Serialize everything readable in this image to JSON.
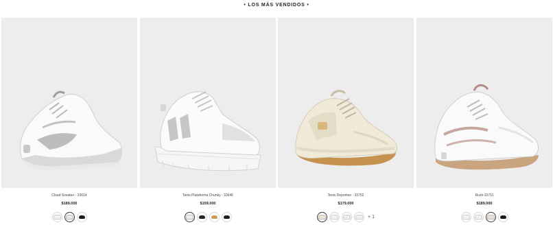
{
  "section": {
    "title": "• LOS MÁS VENDIDOS •"
  },
  "products": [
    {
      "name": "Cloud Sneaker - 33014",
      "price": "$189.000",
      "swatches": [
        {
          "color": "#f2f2f2",
          "selected": false
        },
        {
          "color": "#e9e7e2",
          "selected": true
        },
        {
          "color": "#1c1c1c",
          "selected": false
        }
      ],
      "more": ""
    },
    {
      "name": "Tenis Plataforma Chunky - 33645",
      "price": "$159.000",
      "swatches": [
        {
          "color": "#efeeea",
          "selected": true
        },
        {
          "color": "#2a2624",
          "selected": false
        },
        {
          "color": "#c79a5c",
          "selected": false
        },
        {
          "color": "#1e1e1e",
          "selected": false
        }
      ],
      "more": ""
    },
    {
      "name": "Tenis Deportivo - 33752",
      "price": "$179.000",
      "swatches": [
        {
          "color": "#ebe4d2",
          "selected": true
        },
        {
          "color": "#f1f1f1",
          "selected": false
        },
        {
          "color": "#ededed",
          "selected": false
        },
        {
          "color": "#f0efee",
          "selected": false
        }
      ],
      "more": "+ 1"
    },
    {
      "name": "Rush-33711",
      "price": "$189.000",
      "swatches": [
        {
          "color": "#f2f2f2",
          "selected": false
        },
        {
          "color": "#efefef",
          "selected": false
        },
        {
          "color": "#e9dfd9",
          "selected": true
        },
        {
          "color": "#1b1b1b",
          "selected": false
        }
      ],
      "more": ""
    }
  ]
}
